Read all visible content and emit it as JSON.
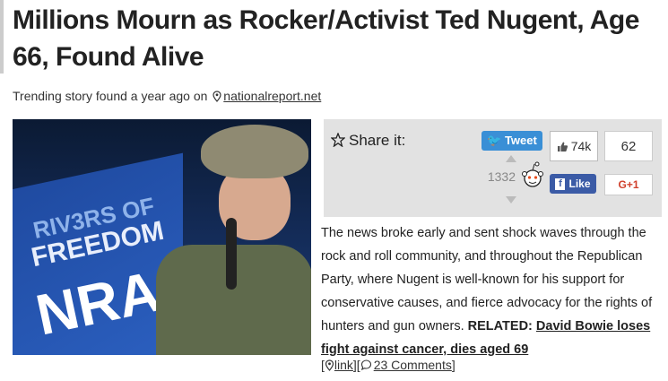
{
  "article": {
    "title": "Millions Mourn as Rocker/Activist Ted Nugent, Age 66, Found Alive",
    "byline_prefix": "Trending story found a year ago on",
    "source_link": "nationalreport.net",
    "paragraph": "The news broke early and sent shock waves through the rock and roll community, and throughout the Republican Party, where Nugent is well-known for his support for conservative causes, and fierce advocacy for the rights of hunters and gun owners.",
    "related_label": "RELATED:",
    "related_link": "David Bowie loses fight against cancer, dies aged 69",
    "link_label": "link",
    "comments_label": "23 Comments",
    "open_bracket": "[",
    "mid_brackets": "][",
    "close_bracket": "]"
  },
  "photo": {
    "sign_line1": "RIV3RS OF",
    "sign_line2": "FREEDOM",
    "sign_line3": "NRA"
  },
  "share": {
    "label": "Share it:",
    "tweet_label": "Tweet",
    "like_count": "74k",
    "gplus_count": "62",
    "reddit_count": "1332",
    "fb_label": "Like",
    "gplus_label": "G+1"
  },
  "icons": [
    "map-pin-icon",
    "star-icon",
    "twitter-bird-icon",
    "thumbs-up-icon",
    "reddit-alien-icon",
    "facebook-f-icon",
    "comment-bubble-icon"
  ],
  "colors": {
    "tweet": "#3a8fd6",
    "facebook": "#3b5ba6",
    "gplus": "#d0402c",
    "share_bg": "#e2e2e2"
  }
}
